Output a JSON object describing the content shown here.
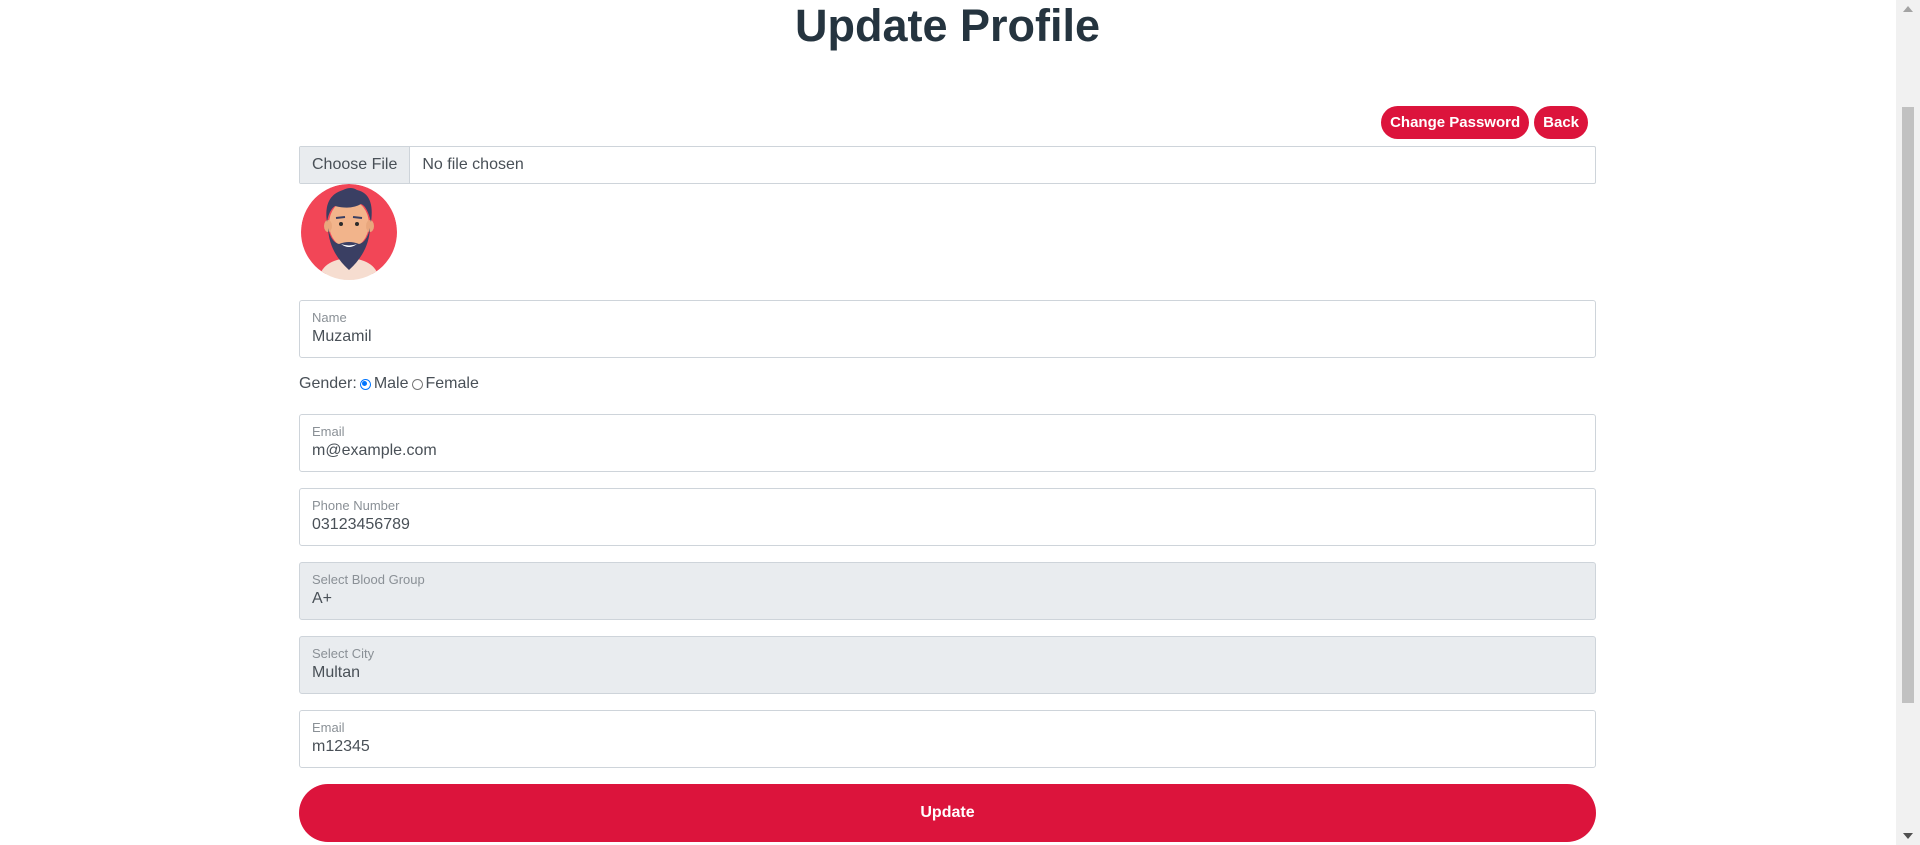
{
  "page": {
    "title": "Update Profile"
  },
  "actions": {
    "change_password": "Change Password",
    "back": "Back"
  },
  "file_input": {
    "button": "Choose File",
    "status": "No file chosen"
  },
  "avatar": {
    "icon": "bearded-man-avatar"
  },
  "form": {
    "name": {
      "label": "Name",
      "value": "Muzamil"
    },
    "gender": {
      "label": "Gender:",
      "options": [
        "Male",
        "Female"
      ],
      "selected": "Male"
    },
    "email": {
      "label": "Email",
      "value": "m@example.com"
    },
    "phone": {
      "label": "Phone Number",
      "value": "03123456789"
    },
    "blood_group": {
      "label": "Select Blood Group",
      "value": "A+"
    },
    "city": {
      "label": "Select City",
      "value": "Multan"
    },
    "password": {
      "label": "Email",
      "value": "m12345"
    }
  },
  "submit": {
    "label": "Update"
  },
  "colors": {
    "accent": "#dc143c",
    "title": "#25343f",
    "disabled_bg": "#e9ecef",
    "radio": "#0075ff"
  }
}
